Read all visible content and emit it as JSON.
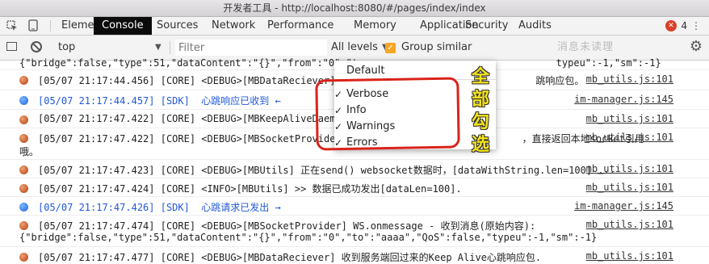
{
  "window": {
    "title": "开发者工具 - http://localhost:8080/#/pages/index/index"
  },
  "tabs": [
    "Elements",
    "Console",
    "Sources",
    "Network",
    "Performance",
    "Memory",
    "Application",
    "Security",
    "Audits"
  ],
  "active_tab": "Console",
  "error_count": "4",
  "toolbar": {
    "context": "top",
    "filter_placeholder": "Filter",
    "levels": "All levels",
    "group_similar": "Group similar",
    "blurred": "消息未读理"
  },
  "dropdown": {
    "default": "Default",
    "items": [
      {
        "label": "Verbose",
        "checked": true
      },
      {
        "label": "Info",
        "checked": true
      },
      {
        "label": "Warnings",
        "checked": true
      },
      {
        "label": "Errors",
        "checked": true
      }
    ]
  },
  "annotation": "全部勾选",
  "logs": {
    "continuation_top": "{\"bridge\":false,\"type\":51,\"dataContent\":\"{}\",\"from\":\"0\",\"t                                  typeu\":-1,\"sm\":-1}",
    "rows": [
      {
        "kind": "core",
        "text": "[05/07 21:17:44.456] [CORE] <DEBUG>[MBDataReciever] 收到                              跳响应包。",
        "source": "mb_utils.js:101"
      },
      {
        "kind": "sdk",
        "text": "[05/07 21:17:44.457] [SDK]  心跳响应已收到 ←",
        "source": "im-manager.js:145"
      },
      {
        "kind": "core",
        "text": "[05/07 21:17:47.422] [CORE] <DEBUG>[MBKeepAliveDaemo",
        "source": "mb_utils.js:101"
      },
      {
        "kind": "core",
        "text": "[05/07 21:17:47.422] [CORE] <DEBUG>[MBSocketProvider]                              ，直接返回本地socket引用",
        "cont": "哦。",
        "source": "mb_utils.js:101"
      },
      {
        "kind": "core",
        "text": "[05/07 21:17:47.423] [CORE] <DEBUG>[MBUtils] 正在send() websocket数据时，[dataWithString.len=100] ...",
        "source": "mb_utils.js:101"
      },
      {
        "kind": "core",
        "text": "[05/07 21:17:47.424] [CORE] <INFO>[MBUtils] >> 数据已成功发出[dataLen=100].",
        "source": "mb_utils.js:101"
      },
      {
        "kind": "sdk",
        "text": "[05/07 21:17:47.426] [SDK]  心跳请求已发出 →",
        "source": "im-manager.js:145"
      },
      {
        "kind": "core",
        "text": "[05/07 21:17:47.474] [CORE] <DEBUG>[MBSocketProvider] WS.onmessage - 收到消息(原始内容):",
        "cont": "{\"bridge\":false,\"type\":51,\"dataContent\":\"{}\",\"from\":\"0\",\"to\":\"aaaa\",\"QoS\":false,\"typeu\":-1,\"sm\":-1}",
        "source": "mb_utils.js:101"
      },
      {
        "kind": "core",
        "text": "[05/07 21:17:47.477] [CORE] <DEBUG>[MBDataReciever] 收到服务端回过来的Keep Alive心跳响应包.",
        "source": "mb_utils.js:101"
      }
    ]
  }
}
